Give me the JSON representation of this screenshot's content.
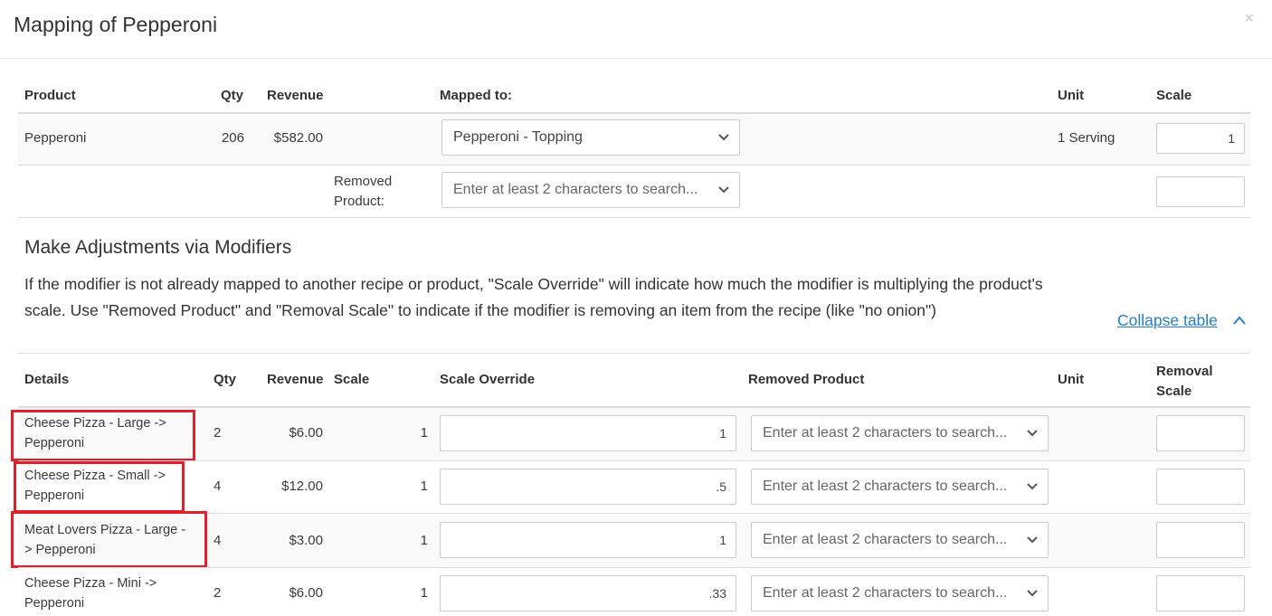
{
  "modal": {
    "title": "Mapping of Pepperoni",
    "close_glyph": "×"
  },
  "product_table": {
    "headers": {
      "product": "Product",
      "qty": "Qty",
      "revenue": "Revenue",
      "mapped_to": "Mapped to:",
      "unit": "Unit",
      "scale": "Scale"
    },
    "row": {
      "product": "Pepperoni",
      "qty": "206",
      "revenue": "$582.00",
      "mapped_to": "Pepperoni - Topping",
      "unit": "1 Serving",
      "scale": "1"
    },
    "removed": {
      "label_line1": "Removed",
      "label_line2": "Product:",
      "placeholder": "Enter at least 2 characters to search...",
      "scale": ""
    }
  },
  "adjustments": {
    "title": "Make Adjustments via Modifiers",
    "description": "If the modifier is not already mapped to another recipe or product, \"Scale Override\" will indicate how much the modifier is multiplying the product's scale. Use \"Removed Product\" and \"Removal Scale\" to indicate if the modifier is removing an item from the recipe (like \"no onion\")",
    "collapse_label": "Collapse table",
    "headers": {
      "details": "Details",
      "qty": "Qty",
      "revenue": "Revenue",
      "scale": "Scale",
      "scale_override": "Scale Override",
      "removed_product": "Removed Product",
      "unit": "Unit",
      "removal_scale_line1": "Removal",
      "removal_scale_line2": "Scale"
    },
    "rows": [
      {
        "detail_line1": "Cheese Pizza - Large ->",
        "detail_line2": "Pepperoni",
        "qty": "2",
        "revenue": "$6.00",
        "scale": "1",
        "scale_override": "1",
        "removed_placeholder": "Enter at least 2 characters to search...",
        "removal_scale": ""
      },
      {
        "detail_line1": "Cheese Pizza - Small ->",
        "detail_line2": "Pepperoni",
        "qty": "4",
        "revenue": "$12.00",
        "scale": "1",
        "scale_override": ".5",
        "removed_placeholder": "Enter at least 2 characters to search...",
        "removal_scale": ""
      },
      {
        "detail_line1": "Meat Lovers Pizza - Large -",
        "detail_line2": "> Pepperoni",
        "qty": "4",
        "revenue": "$3.00",
        "scale": "1",
        "scale_override": "1",
        "removed_placeholder": "Enter at least 2 characters to search...",
        "removal_scale": ""
      },
      {
        "detail_line1": "Cheese Pizza - Mini ->",
        "detail_line2": "Pepperoni",
        "qty": "2",
        "revenue": "$6.00",
        "scale": "1",
        "scale_override": ".33",
        "removed_placeholder": "Enter at least 2 characters to search...",
        "removal_scale": ""
      }
    ]
  },
  "colors": {
    "highlight_border": "#e0212b",
    "link": "#2a7dbf",
    "row_band": "#f9f9f9"
  },
  "icons": {
    "dropdown": "chevron-down-icon",
    "collapse": "caret-up-icon",
    "close": "close-icon"
  }
}
